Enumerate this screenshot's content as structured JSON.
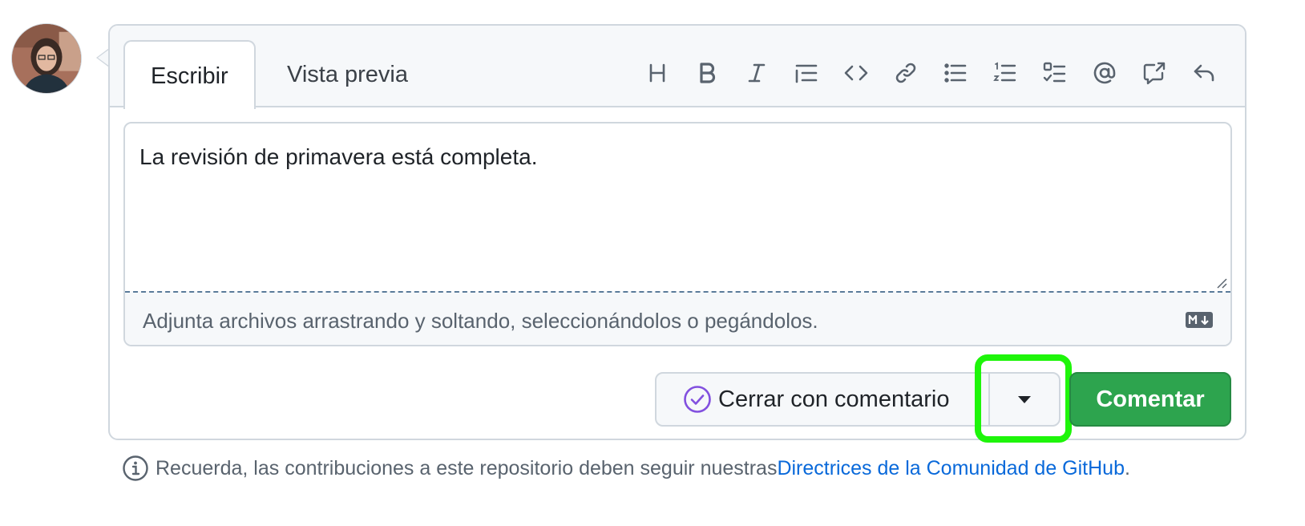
{
  "user": {
    "avatar_icon": "user-avatar"
  },
  "tabs": {
    "write": "Escribir",
    "preview": "Vista previa"
  },
  "toolbar": [
    {
      "name": "heading-icon"
    },
    {
      "name": "bold-icon"
    },
    {
      "name": "italic-icon"
    },
    {
      "name": "quote-icon"
    },
    {
      "name": "code-icon"
    },
    {
      "name": "link-icon"
    },
    {
      "name": "unordered-list-icon"
    },
    {
      "name": "ordered-list-icon"
    },
    {
      "name": "task-list-icon"
    },
    {
      "name": "mention-icon"
    },
    {
      "name": "cross-reference-icon"
    },
    {
      "name": "reply-icon"
    }
  ],
  "editor": {
    "value": "La revisión de primavera está completa.",
    "attach_hint": "Adjunta archivos arrastrando y soltando, seleccionándolos o pegándolos.",
    "markdown_icon": "markdown-icon"
  },
  "actions": {
    "close_with_comment": "Cerrar con comentario",
    "comment": "Comentar",
    "dropdown_icon": "triangle-down-icon"
  },
  "footer": {
    "text": "Recuerda, las contribuciones a este repositorio deben seguir nuestras ",
    "link": "Directrices de la Comunidad de GitHub",
    "suffix": "."
  },
  "colors": {
    "comment_button": "#2da44e",
    "close_icon": "#8250df",
    "link": "#0969da",
    "highlight": "#1ef50a"
  }
}
